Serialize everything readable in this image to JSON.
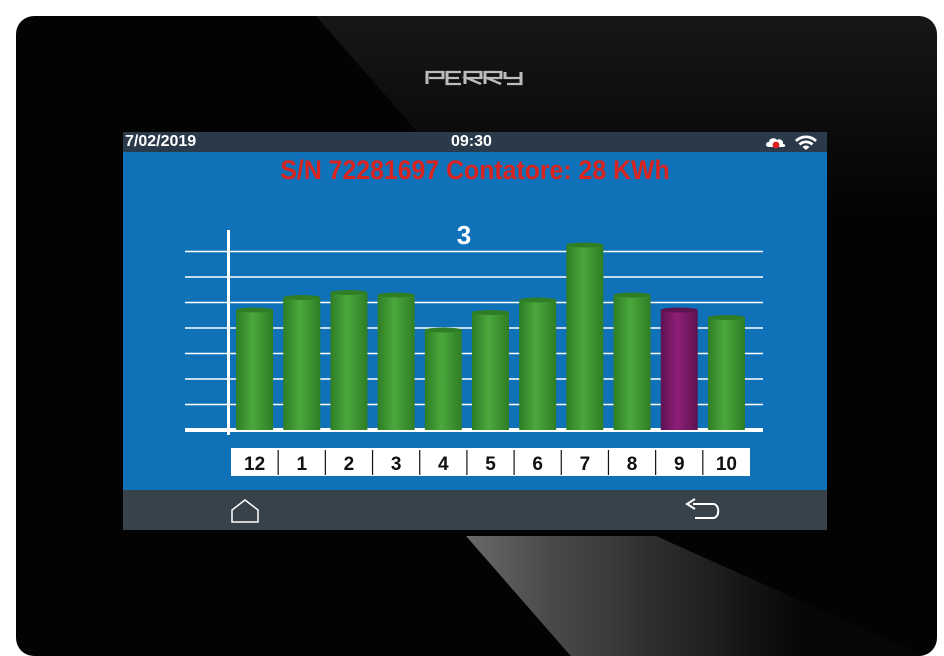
{
  "brand": {
    "logo_text": "PERRY"
  },
  "status_bar": {
    "date": "7/02/2019",
    "time": "09:30",
    "icons": [
      "cloud-alert-icon",
      "wifi-icon"
    ]
  },
  "header": {
    "meter_label": "S/N 72281697 Contatore: 28 KWh"
  },
  "nav": {
    "home_icon": "home-icon",
    "back_icon": "back-icon"
  },
  "chart_data": {
    "type": "bar",
    "title": "3",
    "categories": [
      "12",
      "1",
      "2",
      "3",
      "4",
      "5",
      "6",
      "7",
      "8",
      "9",
      "10"
    ],
    "values": [
      4.8,
      5.3,
      5.5,
      5.4,
      4.0,
      4.7,
      5.2,
      7.4,
      5.4,
      4.8,
      4.5
    ],
    "highlighted_category": "9",
    "ylim": [
      0,
      8
    ],
    "grid": true,
    "colors": {
      "bar": "#4aa83c",
      "bar_dark": "#2f7d25",
      "bar_light": "#7cc45e",
      "highlight": "#8e1f78",
      "highlight_dark": "#5f1250",
      "highlight_light": "#b0399a",
      "title_text": "#ffffff",
      "meter_text": "#d9231f",
      "screen_bg": "#0f72b9"
    }
  }
}
